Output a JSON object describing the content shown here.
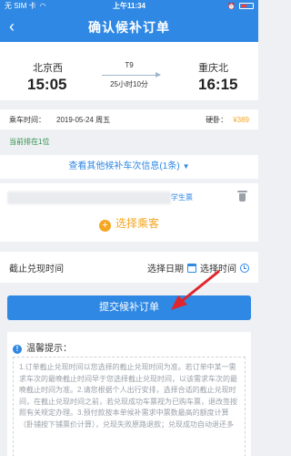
{
  "status_bar": {
    "carrier": "无 SIM 卡",
    "time": "上午11:34"
  },
  "nav": {
    "back_icon": "chevron-left-icon",
    "title": "确认候补订单"
  },
  "train": {
    "from_station": "北京西",
    "from_time": "15:05",
    "number": "T9",
    "duration": "25小时10分",
    "to_station": "重庆北",
    "to_time": "16:15"
  },
  "ride": {
    "date_label": "乘车时间：",
    "date_value": "2019-05-24 周五",
    "seat_label": "硬卧：",
    "price": "¥389"
  },
  "queue_text": "当前排在1位",
  "other_train_link": "查看其他候补车次信息(1条)",
  "passenger": {
    "ticket_type": "学生票",
    "add_label": "选择乘客"
  },
  "deadline": {
    "label": "截止兑现时间",
    "date_placeholder": "选择日期",
    "time_placeholder": "选择时间"
  },
  "submit_label": "提交候补订单",
  "tips": {
    "title": "温馨提示：",
    "body": "1.订单截止兑现时间以您选择的截止兑现时间为准。若订单中某一需求车次的最晚截止时间早于您选择截止兑现时间，以该需求车次的最晚截止时间为准。2.请您根据个人出行安排，选择合适的截止兑现时间，在截止兑现时间之前，若兑现成功车票视为已购车票，退改签按照有关规定办理。3.预付款按本单候补需求中票数最高的额度计算（卧铺按下铺票价计算），兑现失败原路退款；兑现成功自动退还多"
  },
  "colors": {
    "primary": "#2f88e4",
    "accent": "#f5a623",
    "queue_green": "#2f8f4a",
    "pointer_red": "#e0252c"
  }
}
